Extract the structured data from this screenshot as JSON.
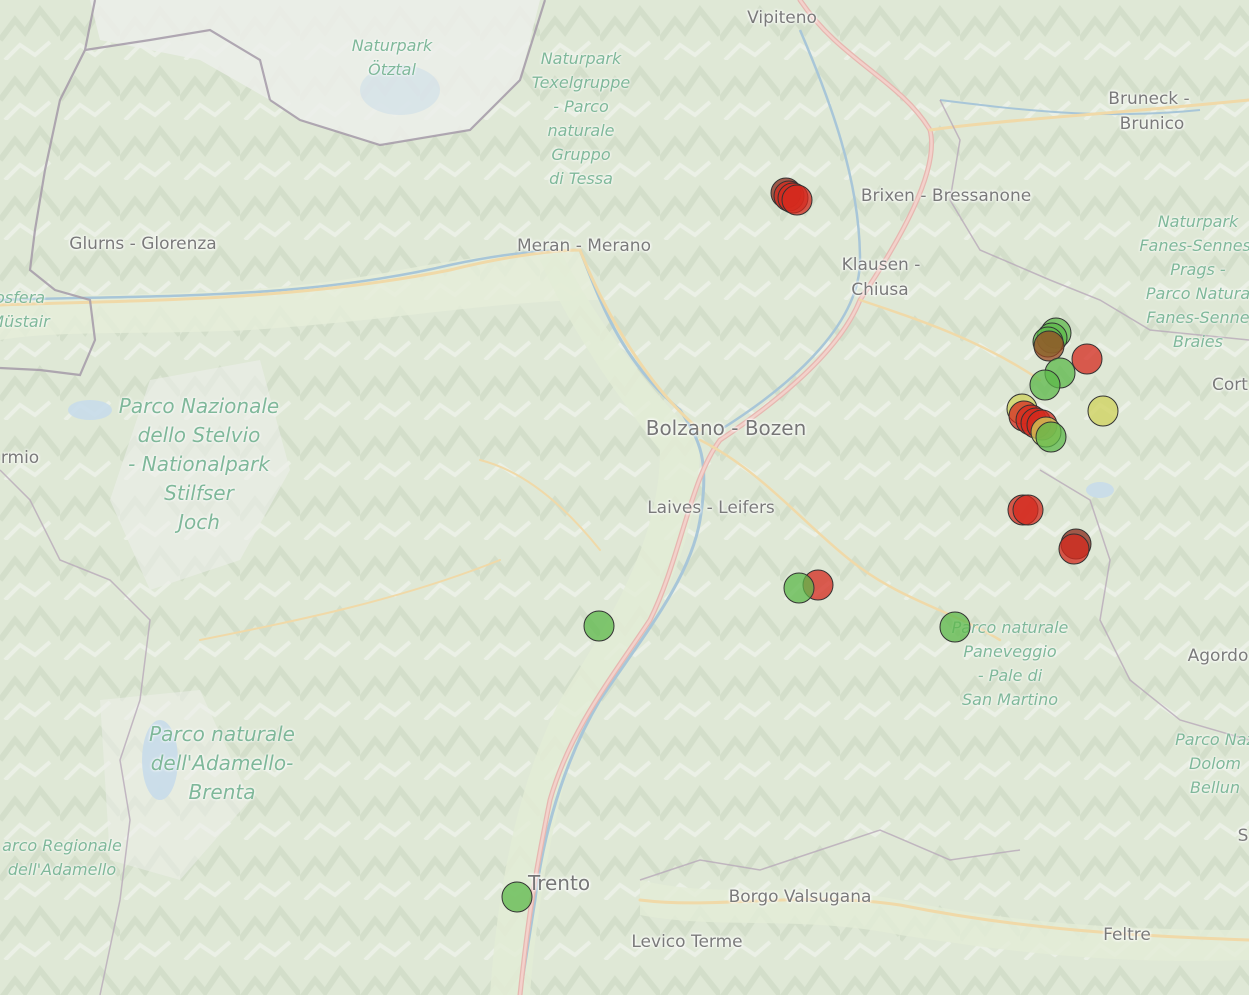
{
  "places": [
    {
      "id": "vipiteno",
      "text": "Vipiteno",
      "cls": "town"
    },
    {
      "id": "bruneck1",
      "text": "Bruneck -",
      "cls": "town"
    },
    {
      "id": "bruneck2",
      "text": "Brunico",
      "cls": "town"
    },
    {
      "id": "brixen",
      "text": "Brixen - Bressanone",
      "cls": "town"
    },
    {
      "id": "glurns",
      "text": "Glurns - Glorenza",
      "cls": "town"
    },
    {
      "id": "meran",
      "text": "Meran - Merano",
      "cls": "town"
    },
    {
      "id": "klausen1",
      "text": "Klausen -",
      "cls": "town"
    },
    {
      "id": "klausen2",
      "text": "Chiusa",
      "cls": "town"
    },
    {
      "id": "bolzano",
      "text": "Bolzano - Bozen",
      "cls": "city"
    },
    {
      "id": "laives",
      "text": "Laives - Leifers",
      "cls": "town"
    },
    {
      "id": "bormio",
      "text": "rmio",
      "cls": "town"
    },
    {
      "id": "cort",
      "text": "Cort",
      "cls": "town"
    },
    {
      "id": "agordo",
      "text": "Agordo",
      "cls": "town"
    },
    {
      "id": "trento",
      "text": "Trento",
      "cls": "city"
    },
    {
      "id": "borgo",
      "text": "Borgo Valsugana",
      "cls": "town"
    },
    {
      "id": "levico",
      "text": "Levico Terme",
      "cls": "town"
    },
    {
      "id": "feltre",
      "text": "Feltre",
      "cls": "town"
    },
    {
      "id": "s",
      "text": "S",
      "cls": "town"
    }
  ],
  "parks": [
    {
      "id": "otztal",
      "lines": [
        "Naturpark",
        "Ötztal"
      ],
      "cls": "small"
    },
    {
      "id": "texel",
      "lines": [
        "Naturpark",
        "Texelgruppe",
        "- Parco",
        "naturale",
        "Gruppo",
        "di Tessa"
      ],
      "cls": "small"
    },
    {
      "id": "fanes",
      "lines": [
        "Naturpark",
        "Fanes-Sennes-",
        "Prags -",
        "Parco Natura",
        "Fanes-Senne",
        "Braies"
      ],
      "cls": "small"
    },
    {
      "id": "biosfera",
      "lines": [
        "osfera",
        "Müstair"
      ],
      "cls": "small"
    },
    {
      "id": "stelvio",
      "lines": [
        "Parco Nazionale",
        "dello Stelvio",
        "- Nationalpark",
        "Stilfser",
        "Joch"
      ],
      "cls": "big"
    },
    {
      "id": "adamello",
      "lines": [
        "Parco naturale",
        "dell'Adamello-",
        "Brenta"
      ],
      "cls": "big"
    },
    {
      "id": "adamello_reg",
      "lines": [
        "arco Regionale",
        "dell'Adamello"
      ],
      "cls": "small"
    },
    {
      "id": "paneveggio",
      "lines": [
        "Parco naturale",
        "Paneveggio",
        "- Pale di",
        "San Martino"
      ],
      "cls": "small"
    },
    {
      "id": "dolomiti",
      "lines": [
        "Parco Naz",
        "Dolom",
        "Bellun"
      ],
      "cls": "small"
    }
  ],
  "markers": [
    {
      "cat": "darkred"
    },
    {
      "cat": "red"
    },
    {
      "cat": "red"
    },
    {
      "cat": "red"
    },
    {
      "cat": "green"
    },
    {
      "cat": "green"
    },
    {
      "cat": "green"
    },
    {
      "cat": "brown"
    },
    {
      "cat": "red"
    },
    {
      "cat": "green"
    },
    {
      "cat": "green"
    },
    {
      "cat": "yellow"
    },
    {
      "cat": "yellow"
    },
    {
      "cat": "red"
    },
    {
      "cat": "red"
    },
    {
      "cat": "red"
    },
    {
      "cat": "red"
    },
    {
      "cat": "yellow"
    },
    {
      "cat": "green"
    },
    {
      "cat": "red"
    },
    {
      "cat": "red"
    },
    {
      "cat": "darkred"
    },
    {
      "cat": "red"
    },
    {
      "cat": "red"
    },
    {
      "cat": "green"
    },
    {
      "cat": "green"
    },
    {
      "cat": "green"
    },
    {
      "cat": "green"
    }
  ],
  "marker_colors": {
    "green": "#5cb84a",
    "red": "#d42a1e",
    "darkred": "#8b2a1a",
    "brown": "#9a4a22",
    "yellow": "#cfd25a"
  }
}
